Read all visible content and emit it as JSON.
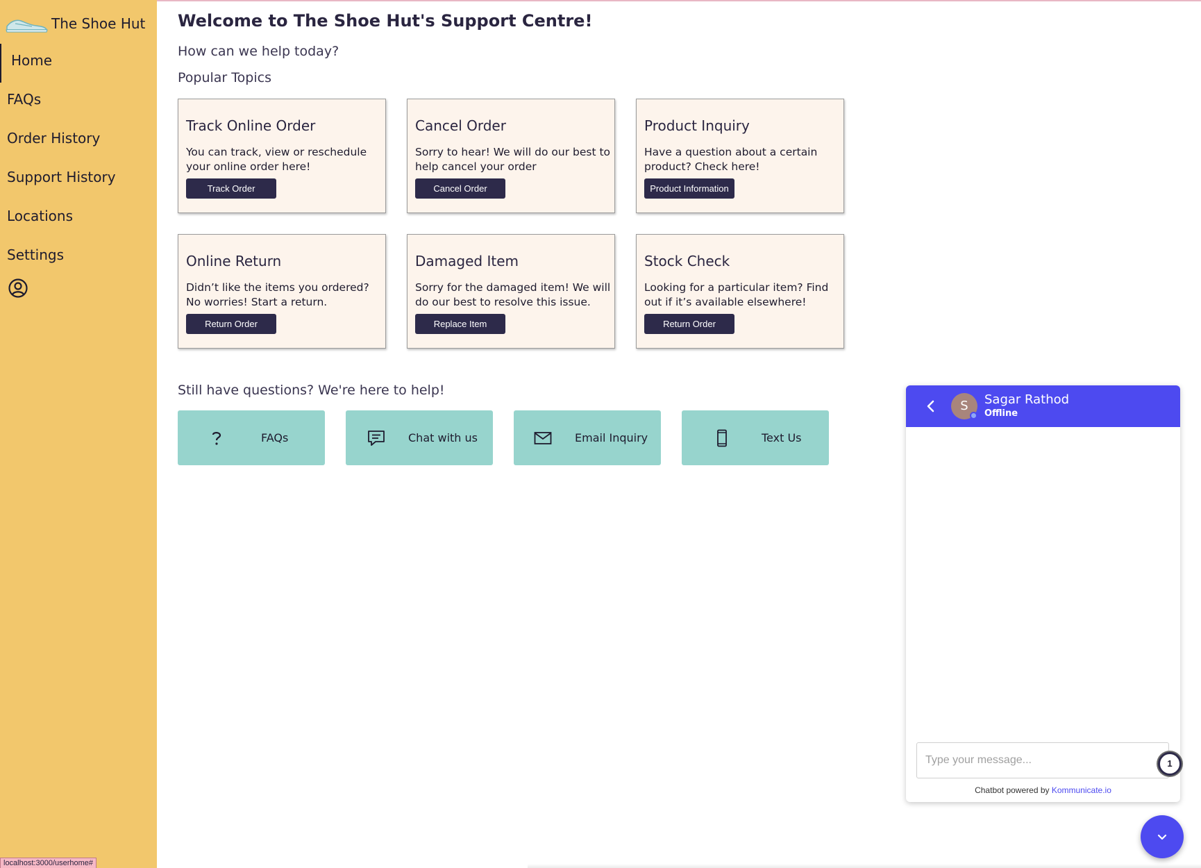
{
  "brand": {
    "name": "The Shoe Hut",
    "logo_icon": "sneaker-logo"
  },
  "nav": {
    "items": [
      {
        "label": "Home",
        "active": true
      },
      {
        "label": "FAQs"
      },
      {
        "label": "Order History"
      },
      {
        "label": "Support History"
      },
      {
        "label": "Locations"
      },
      {
        "label": "Settings"
      }
    ],
    "profile_icon": "user-circle-icon"
  },
  "main": {
    "title": "Welcome to The Shoe Hut's Support Centre!",
    "subtitle": "How can we help today?",
    "popular_title": "Popular Topics",
    "cards": [
      {
        "title": "Track Online Order",
        "description": "You can track, view or reschedule your online order here!",
        "button": "Track Order"
      },
      {
        "title": "Cancel Order",
        "description": "Sorry to hear! We will do our best to help cancel your order",
        "button": "Cancel Order"
      },
      {
        "title": "Product Inquiry",
        "description": "Have a question about a certain product? Check here!",
        "button": "Product Information"
      },
      {
        "title": "Online Return",
        "description": "Didn’t like the items you ordered? No worries! Start a return.",
        "button": "Return Order"
      },
      {
        "title": "Damaged Item",
        "description": "Sorry for the damaged item! We will do our best to resolve this issue.",
        "button": "Replace Item"
      },
      {
        "title": "Stock Check",
        "description": "Looking for a particular item? Find out if it’s available elsewhere!",
        "button": "Return Order"
      }
    ],
    "help_title": "Still have questions? We're here to help!",
    "help_tiles": [
      {
        "label": "FAQs",
        "icon": "question-mark-icon"
      },
      {
        "label": "Chat with us",
        "icon": "chat-bubble-icon"
      },
      {
        "label": "Email Inquiry",
        "icon": "envelope-icon"
      },
      {
        "label": "Text Us",
        "icon": "phone-icon"
      }
    ]
  },
  "chat": {
    "agent_initial": "S",
    "agent_name": "Sagar Rathod",
    "agent_status": "Offline",
    "input_placeholder": "Type your message...",
    "footer_prefix": "Chatbot powered by",
    "footer_link": "Kommunicate.io",
    "notification_count": "1",
    "header_color": "#4d4af0"
  },
  "status_bar": {
    "url": "localhost:3000/userhome#"
  },
  "colors": {
    "sidebar": "#f2c76c",
    "card_bg": "#fdf4ec",
    "button_dark": "#2d2a4a",
    "tile": "#97d4cd",
    "chat_accent": "#4d4af0"
  }
}
